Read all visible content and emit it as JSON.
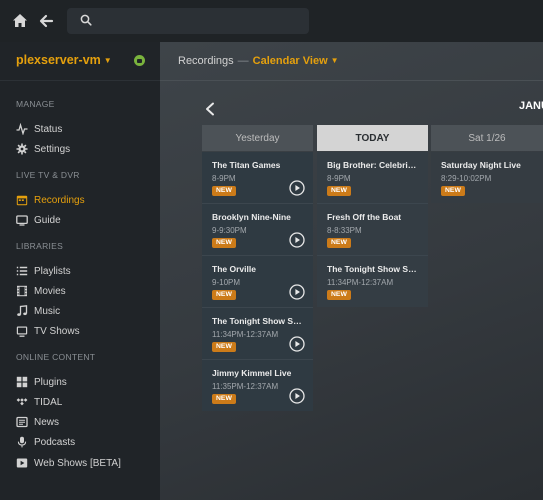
{
  "server": {
    "name": "plexserver-vm"
  },
  "sidebar": {
    "sections": [
      {
        "title": "MANAGE",
        "items": [
          {
            "label": "Status",
            "icon": "activity-icon"
          },
          {
            "label": "Settings",
            "icon": "gear-icon"
          }
        ]
      },
      {
        "title": "LIVE TV & DVR",
        "items": [
          {
            "label": "Recordings",
            "icon": "calendar-icon",
            "active": true
          },
          {
            "label": "Guide",
            "icon": "tv-icon"
          }
        ]
      },
      {
        "title": "LIBRARIES",
        "items": [
          {
            "label": "Playlists",
            "icon": "playlist-icon"
          },
          {
            "label": "Movies",
            "icon": "film-icon"
          },
          {
            "label": "Music",
            "icon": "music-note-icon"
          },
          {
            "label": "TV Shows",
            "icon": "tv-shows-icon"
          }
        ]
      },
      {
        "title": "ONLINE CONTENT",
        "items": [
          {
            "label": "Plugins",
            "icon": "plugins-grid-icon"
          },
          {
            "label": "TIDAL",
            "icon": "tidal-icon"
          },
          {
            "label": "News",
            "icon": "news-icon"
          },
          {
            "label": "Podcasts",
            "icon": "microphone-icon"
          },
          {
            "label": "Web Shows [BETA]",
            "icon": "web-show-icon"
          }
        ]
      }
    ]
  },
  "header": {
    "section": "Recordings",
    "separator": "—",
    "view": "Calendar View"
  },
  "calendar": {
    "month_label": "JANU",
    "days": [
      {
        "label": "Yesterday",
        "entries": [
          {
            "title": "The Titan Games",
            "time": "8-9PM",
            "badge": "NEW"
          },
          {
            "title": "Brooklyn Nine-Nine",
            "time": "9-9:30PM",
            "badge": "NEW"
          },
          {
            "title": "The Orville",
            "time": "9-10PM",
            "badge": "NEW"
          },
          {
            "title": "The Tonight Show Starring Jimmy Fallon",
            "time": "11:34PM-12:37AM",
            "badge": "NEW"
          },
          {
            "title": "Jimmy Kimmel Live",
            "time": "11:35PM-12:37AM",
            "badge": "NEW"
          }
        ]
      },
      {
        "label": "TODAY",
        "entries": [
          {
            "title": "Big Brother: Celebrity Edition",
            "time": "8-9PM",
            "badge": "NEW"
          },
          {
            "title": "Fresh Off the Boat",
            "time": "8-8:33PM",
            "badge": "NEW"
          },
          {
            "title": "The Tonight Show Starring Jimmy Fallon",
            "time": "11:34PM-12:37AM",
            "badge": "NEW"
          }
        ]
      },
      {
        "label": "Sat 1/26",
        "entries": [
          {
            "title": "Saturday Night Live",
            "time": "8:29-10:02PM",
            "badge": "NEW"
          }
        ]
      }
    ]
  },
  "colors": {
    "accent": "#e5a00d",
    "badge": "#cc7b19",
    "sidebar_bg": "#202428"
  }
}
